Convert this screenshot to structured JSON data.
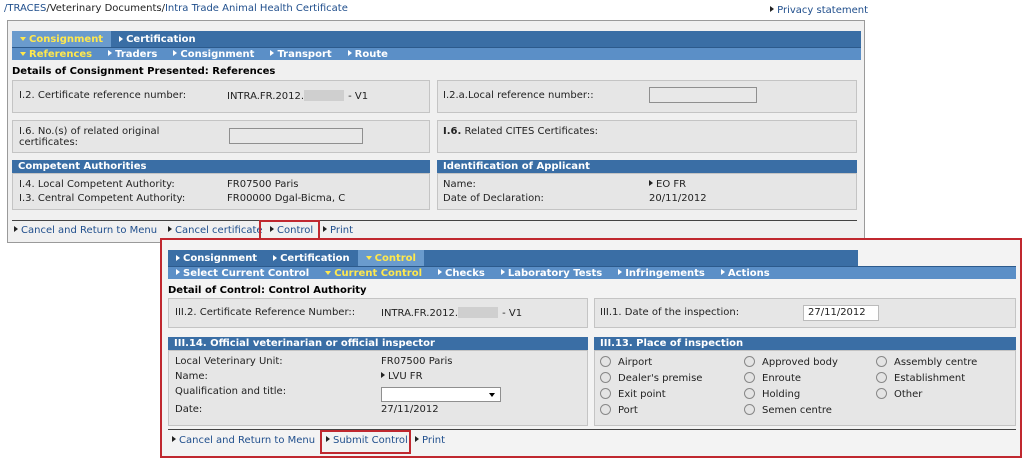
{
  "breadcrumb": {
    "home": "/TRACES",
    "section": "/Veterinary Documents/",
    "current": "Intra Trade Animal Health Certificate"
  },
  "privacy_link": "Privacy statement",
  "panel1": {
    "tabs": [
      "Consignment",
      "Certification"
    ],
    "subtabs": [
      "References",
      "Traders",
      "Consignment",
      "Transport",
      "Route"
    ],
    "title": "Details of Consignment Presented: References",
    "cert_ref_label": "I.2. Certificate reference number:",
    "cert_ref_prefix": "INTRA.FR.2012.",
    "cert_ref_suffix": "- V1",
    "local_ref_label": "I.2.a.Local reference number::",
    "related_orig_label": "I.6. No.(s) of related original certificates:",
    "related_cites_label": "I.6.",
    "related_cites_text": "Related CITES Certificates:",
    "competent_header": "Competent Authorities",
    "applicant_header": "Identification of Applicant",
    "local_auth_label": "I.4. Local Competent Authority:",
    "local_auth_value": "FR07500 Paris",
    "central_auth_label": "I.3. Central Competent Authority:",
    "central_auth_value": "FR00000 Dgal-Bicma, C",
    "name_label": "Name:",
    "name_value": "EO FR",
    "date_decl_label": "Date of Declaration:",
    "date_decl_value": "20/11/2012",
    "actions": [
      "Cancel and Return to Menu",
      "Cancel certificate",
      "Control",
      "Print"
    ]
  },
  "panel2": {
    "tabs": [
      "Consignment",
      "Certification",
      "Control"
    ],
    "subtabs": [
      "Select Current Control",
      "Current Control",
      "Checks",
      "Laboratory Tests",
      "Infringements",
      "Actions"
    ],
    "title": "Detail of Control: Control Authority",
    "cert_ref_label": "III.2. Certificate Reference Number::",
    "cert_ref_prefix": "INTRA.FR.2012.",
    "cert_ref_suffix": "- V1",
    "inspection_date_label": "III.1. Date of the inspection:",
    "inspection_date_value": "27/11/2012",
    "vet_header": "III.14. Official veterinarian or official inspector",
    "place_header": "III.13. Place of inspection",
    "lvu_label": "Local Veterinary Unit:",
    "lvu_value": "FR07500 Paris",
    "name_label": "Name:",
    "name_value": "LVU FR",
    "qual_label": "Qualification and title:",
    "date_label": "Date:",
    "date_value": "27/11/2012",
    "places": [
      [
        "Airport",
        "Dealer's premise",
        "Exit point",
        "Port"
      ],
      [
        "Approved body",
        "Enroute",
        "Holding",
        "Semen centre"
      ],
      [
        "Assembly centre",
        "Establishment",
        "Other"
      ]
    ],
    "actions": [
      "Cancel and Return to Menu",
      "Submit Control",
      "Print"
    ]
  }
}
